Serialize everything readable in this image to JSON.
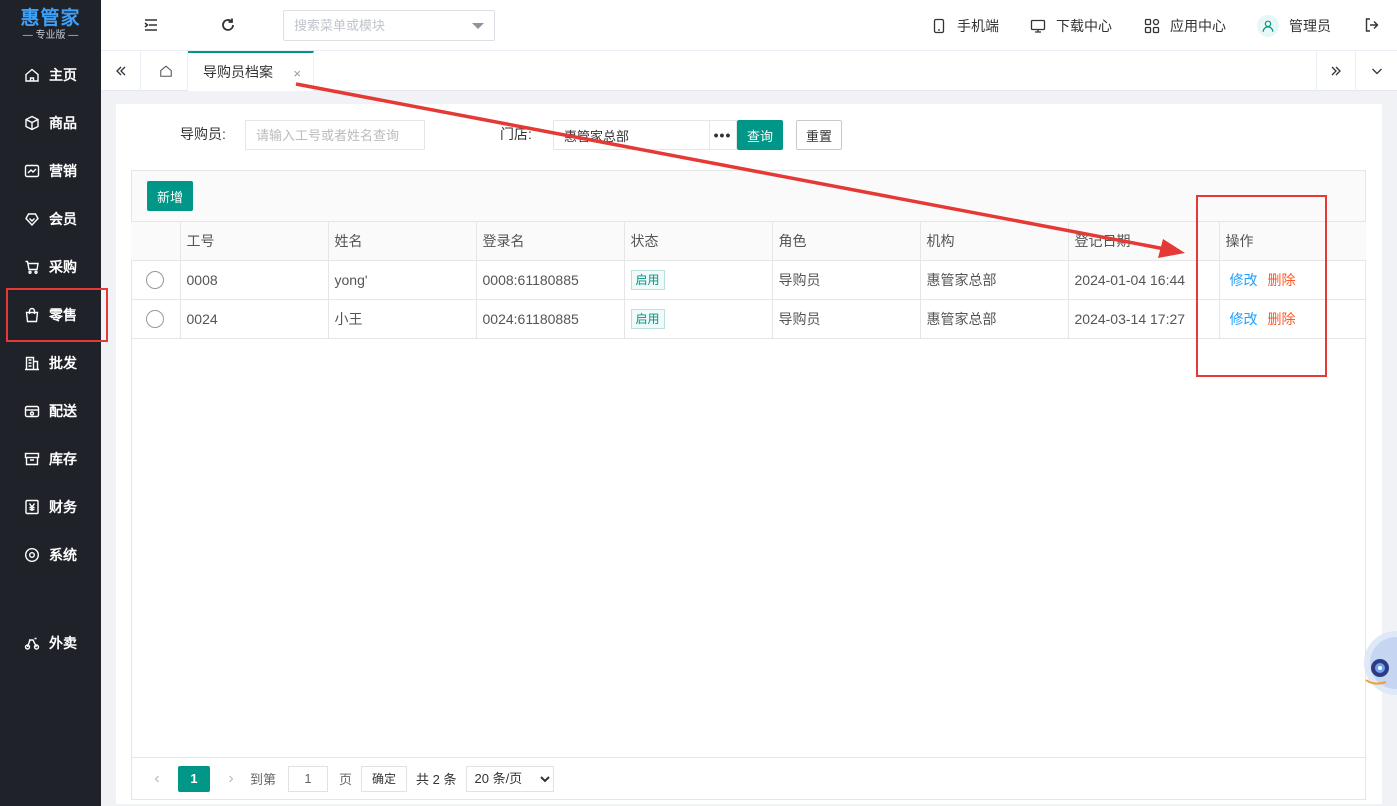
{
  "app": {
    "logo_title": "惠管家",
    "logo_sub": "— 专业版 —"
  },
  "sidebar": {
    "items": [
      {
        "label": "主页",
        "icon": "home-icon"
      },
      {
        "label": "商品",
        "icon": "box-icon"
      },
      {
        "label": "营销",
        "icon": "trend-chart-icon"
      },
      {
        "label": "会员",
        "icon": "member-heart-icon"
      },
      {
        "label": "采购",
        "icon": "cart-icon"
      },
      {
        "label": "零售",
        "icon": "shopping-bag-icon"
      },
      {
        "label": "批发",
        "icon": "building-icon"
      },
      {
        "label": "配送",
        "icon": "delivery-icon"
      },
      {
        "label": "库存",
        "icon": "inventory-icon"
      },
      {
        "label": "财务",
        "icon": "finance-yen-icon"
      },
      {
        "label": "系统",
        "icon": "system-settings-icon"
      },
      {
        "label": "外卖",
        "icon": "scooter-icon"
      }
    ]
  },
  "header": {
    "search_placeholder": "搜索菜单或模块",
    "mobile": "手机端",
    "download": "下载中心",
    "apps": "应用中心",
    "user": "管理员"
  },
  "tabs": {
    "active_label": "导购员档案",
    "close": "×"
  },
  "filters": {
    "guide_label": "导购员:",
    "guide_placeholder": "请输入工号或者姓名查询",
    "store_label": "门店:",
    "store_value": "惠管家总部",
    "more": "•••",
    "query": "查询",
    "reset": "重置"
  },
  "toolbar": {
    "add": "新增"
  },
  "table": {
    "columns": [
      "",
      "工号",
      "姓名",
      "登录名",
      "状态",
      "角色",
      "机构",
      "登记日期",
      "操作"
    ],
    "rows": [
      {
        "id": "0008",
        "name": "yong'",
        "login": "0008:61180885",
        "status": "启用",
        "role": "导购员",
        "org": "惠管家总部",
        "date": "2024-01-04 16:44",
        "edit": "修改",
        "delete": "删除"
      },
      {
        "id": "0024",
        "name": "小王",
        "login": "0024:61180885",
        "status": "启用",
        "role": "导购员",
        "org": "惠管家总部",
        "date": "2024-03-14 17:27",
        "edit": "修改",
        "delete": "删除"
      }
    ]
  },
  "pager": {
    "current": "1",
    "goto_label": "到第",
    "goto_value": "1",
    "page_unit": "页",
    "confirm": "确定",
    "total": "共 2 条",
    "page_size": "20 条/页"
  },
  "colors": {
    "accent": "#009688",
    "sidebar_bg": "#1f2229",
    "annotation": "#e53935",
    "link": "#1e9fff",
    "danger": "#ff5722"
  }
}
